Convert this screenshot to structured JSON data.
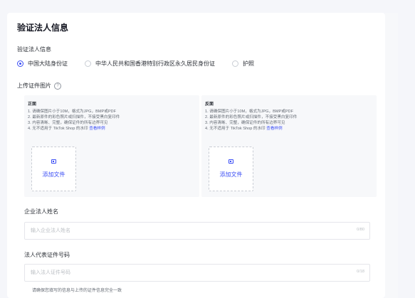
{
  "section_title": "验证法人信息",
  "id_type": {
    "label": "验证法人信息",
    "options": [
      "中国大陆身份证",
      "中华人民共和国香港特别行政区永久居民身份证",
      "护照"
    ],
    "selected_index": 0
  },
  "upload": {
    "label": "上传证件图片",
    "help_icon_glyph": "?",
    "panels": [
      {
        "title": "正面",
        "rules": [
          "1. 请确保图片小于10M，格式为JPG，BMP或PDF",
          "2. 最新原件的彩色照片或扫描件，不接受黑白复印件",
          "3. 内容清晰、完整，确保证件的所有边界可见",
          "4. 无不适用于 TikTok Shop 的水印"
        ],
        "example_link": "查看样例",
        "upload_text": "添加文件"
      },
      {
        "title": "反面",
        "rules": [
          "1. 请确保图片小于10M，格式为JPG，BMP或PDF",
          "2. 最新原件的彩色照片或扫描件，不接受黑白复印件",
          "3. 内容清晰、完整，确保证件的所有边界可见",
          "4. 无不适用于 TikTok Shop 的水印"
        ],
        "example_link": "查看样例",
        "upload_text": "添加文件"
      }
    ]
  },
  "legal_name": {
    "label": "企业法人姓名",
    "placeholder": "输入企业法人姓名",
    "value": "",
    "counter": "0/80"
  },
  "legal_id_number": {
    "label": "法人代表证件号码",
    "placeholder": "输入法人证件号码",
    "value": "",
    "counter": "0/18"
  },
  "hint": "请确保您填写的信息与上传的证件信息完全一致",
  "colors": {
    "accent": "#3b4ef5",
    "panel_bg": "#f7f8fa",
    "page_bg": "#f5f6fa"
  }
}
